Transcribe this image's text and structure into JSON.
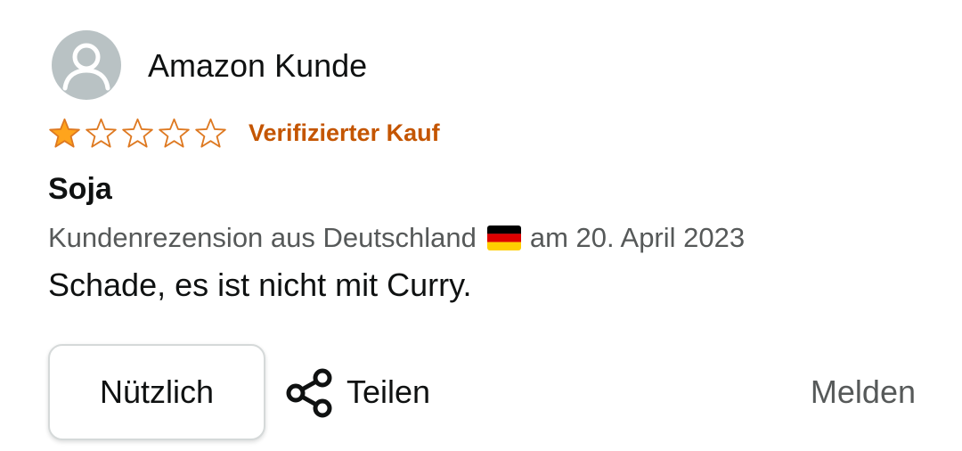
{
  "reviewer": {
    "name": "Amazon Kunde",
    "avatar_icon": "user-profile-icon"
  },
  "rating": {
    "value": 1,
    "max": 5,
    "filled_color": "#ffa41c",
    "outline_color": "#de7921"
  },
  "verified_label": "Verifizierter Kauf",
  "title": "Soja",
  "meta": {
    "prefix": "Kundenrezension aus Deutschland",
    "flag_icon": "germany-flag-icon",
    "suffix": "am 20. April 2023"
  },
  "body": "Schade, es ist nicht mit Curry.",
  "actions": {
    "helpful_label": "Nützlich",
    "share_label": "Teilen",
    "share_icon": "share-icon",
    "report_label": "Melden"
  },
  "colors": {
    "verified": "#c45500",
    "meta_text": "#565959",
    "primary_text": "#0f1111"
  }
}
